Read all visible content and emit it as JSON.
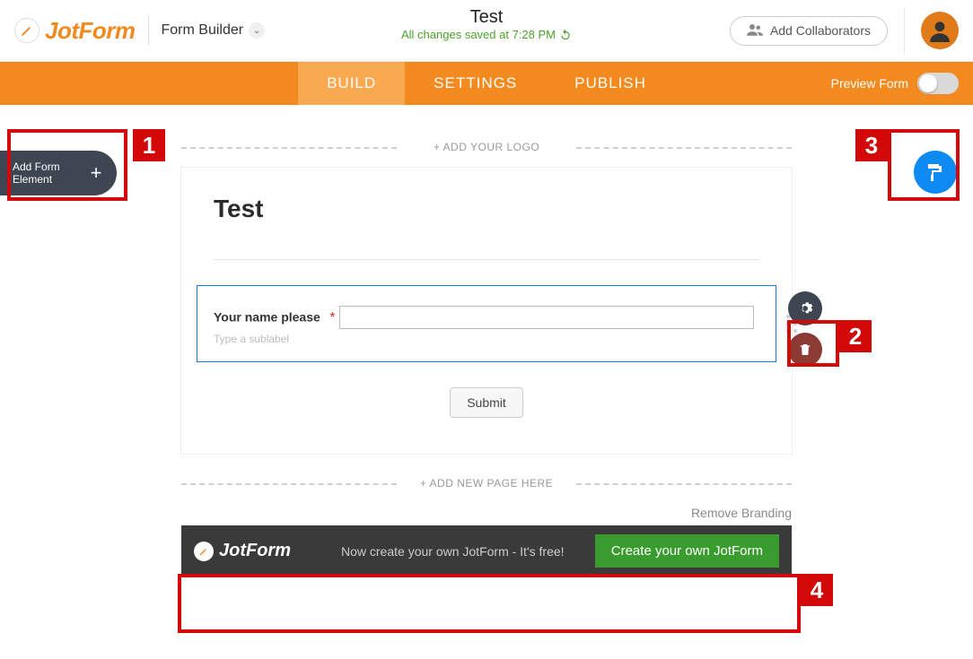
{
  "header": {
    "brand": "JotForm",
    "subtitle": "Form Builder",
    "form_name": "Test",
    "saved_msg": "All changes saved at 7:28 PM",
    "collab_label": "Add Collaborators"
  },
  "nav": {
    "tabs": [
      "BUILD",
      "SETTINGS",
      "PUBLISH"
    ],
    "preview_label": "Preview Form"
  },
  "sidebar": {
    "add_element": "Add Form\nElement"
  },
  "canvas": {
    "logo_hint": "+ ADD YOUR LOGO",
    "new_page_hint": "+ ADD NEW PAGE HERE",
    "remove_branding": "Remove Branding"
  },
  "form": {
    "heading": "Test",
    "field": {
      "label": "Your name please",
      "required": "*",
      "value": "",
      "sublabel_placeholder": "Type a sublabel"
    },
    "submit": "Submit"
  },
  "promo": {
    "brand": "JotForm",
    "text": "Now create your own JotForm - It's free!",
    "cta": "Create your own JotForm"
  },
  "annotations": {
    "n1": "1",
    "n2": "2",
    "n3": "3",
    "n4": "4"
  }
}
